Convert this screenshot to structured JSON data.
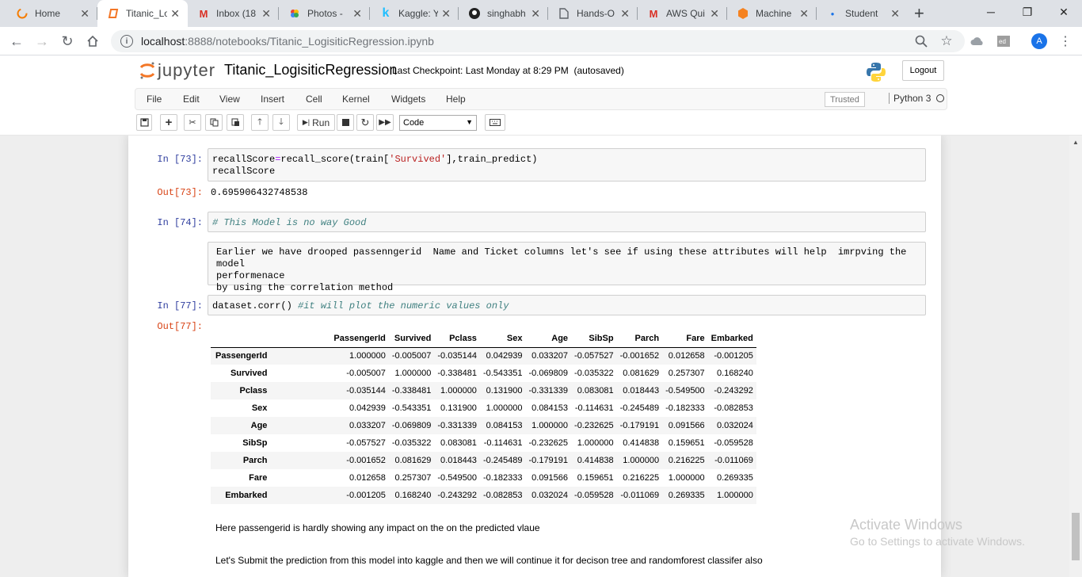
{
  "browser": {
    "tabs": [
      {
        "title": "Home",
        "icon": "circle-loading-icon",
        "color": "#f57c00"
      },
      {
        "title": "Titanic_Lo",
        "icon": "notebook-icon",
        "color": "#f37626"
      },
      {
        "title": "Inbox (18",
        "icon": "gmail-icon",
        "color": "#d93025"
      },
      {
        "title": "Photos -",
        "icon": "photos-icon",
        "color": "#fbbc04"
      },
      {
        "title": "Kaggle: Y",
        "icon": "kaggle-icon",
        "color": "#20beff"
      },
      {
        "title": "singhabh",
        "icon": "github-icon",
        "color": "#222222"
      },
      {
        "title": "Hands-O",
        "icon": "document-icon",
        "color": "#5f6368"
      },
      {
        "title": "AWS Qui",
        "icon": "gmail-icon",
        "color": "#d93025"
      },
      {
        "title": "Machine",
        "icon": "box-icon",
        "color": "#f58220"
      },
      {
        "title": "Student",
        "icon": "dot-icon",
        "color": "#1a73e8"
      }
    ],
    "url": "localhost:8888/notebooks/Titanic_LogisiticRegression.ipynb",
    "url_host": "localhost",
    "url_path": ":8888/notebooks/Titanic_LogisiticRegression.ipynb",
    "profile_initial": "A"
  },
  "jupyter": {
    "logo_text": "jupyter",
    "notebook_name": "Titanic_LogisiticRegression",
    "checkpoint": "Last Checkpoint: Last Monday at 8:29 PM",
    "autosave": "(autosaved)",
    "logout": "Logout",
    "menu": [
      "File",
      "Edit",
      "View",
      "Insert",
      "Cell",
      "Kernel",
      "Widgets",
      "Help"
    ],
    "trusted": "Trusted",
    "kernel_name": "Python 3",
    "run_label": "Run",
    "cell_type": "Code"
  },
  "cells": {
    "c73": {
      "in_prompt": "In [73]:",
      "out_prompt": "Out[73]:",
      "output": "0.695906432748538"
    },
    "c74": {
      "in_prompt": "In [74]:",
      "code": "# This Model is no way Good"
    },
    "raw": {
      "text": "Earlier we have drooped passenngerid  Name and Ticket columns let's see if using these attributes will help  imrpving the model\nperformenace\nby using the correlation method"
    },
    "c77": {
      "in_prompt": "In [77]:",
      "out_prompt": "Out[77]:"
    },
    "md1": "Here passengerid is hardly showing any impact on the on the predicted vlaue",
    "md2": "Let's Submit the prediction from this model into kaggle and then we will continue it for decison tree and randomforest classifer also"
  },
  "corr": {
    "columns": [
      "PassengerId",
      "Survived",
      "Pclass",
      "Sex",
      "Age",
      "SibSp",
      "Parch",
      "Fare",
      "Embarked"
    ],
    "rows": [
      {
        "label": "PassengerId",
        "values": [
          "1.000000",
          "-0.005007",
          "-0.035144",
          "0.042939",
          "0.033207",
          "-0.057527",
          "-0.001652",
          "0.012658",
          "-0.001205"
        ]
      },
      {
        "label": "Survived",
        "values": [
          "-0.005007",
          "1.000000",
          "-0.338481",
          "-0.543351",
          "-0.069809",
          "-0.035322",
          "0.081629",
          "0.257307",
          "0.168240"
        ]
      },
      {
        "label": "Pclass",
        "values": [
          "-0.035144",
          "-0.338481",
          "1.000000",
          "0.131900",
          "-0.331339",
          "0.083081",
          "0.018443",
          "-0.549500",
          "-0.243292"
        ]
      },
      {
        "label": "Sex",
        "values": [
          "0.042939",
          "-0.543351",
          "0.131900",
          "1.000000",
          "0.084153",
          "-0.114631",
          "-0.245489",
          "-0.182333",
          "-0.082853"
        ]
      },
      {
        "label": "Age",
        "values": [
          "0.033207",
          "-0.069809",
          "-0.331339",
          "0.084153",
          "1.000000",
          "-0.232625",
          "-0.179191",
          "0.091566",
          "0.032024"
        ]
      },
      {
        "label": "SibSp",
        "values": [
          "-0.057527",
          "-0.035322",
          "0.083081",
          "-0.114631",
          "-0.232625",
          "1.000000",
          "0.414838",
          "0.159651",
          "-0.059528"
        ]
      },
      {
        "label": "Parch",
        "values": [
          "-0.001652",
          "0.081629",
          "0.018443",
          "-0.245489",
          "-0.179191",
          "0.414838",
          "1.000000",
          "0.216225",
          "-0.011069"
        ]
      },
      {
        "label": "Fare",
        "values": [
          "0.012658",
          "0.257307",
          "-0.549500",
          "-0.182333",
          "0.091566",
          "0.159651",
          "0.216225",
          "1.000000",
          "0.269335"
        ]
      },
      {
        "label": "Embarked",
        "values": [
          "-0.001205",
          "0.168240",
          "-0.243292",
          "-0.082853",
          "0.032024",
          "-0.059528",
          "-0.011069",
          "0.269335",
          "1.000000"
        ]
      }
    ]
  },
  "watermark": {
    "line1": "Activate Windows",
    "line2": "Go to Settings to activate Windows."
  }
}
